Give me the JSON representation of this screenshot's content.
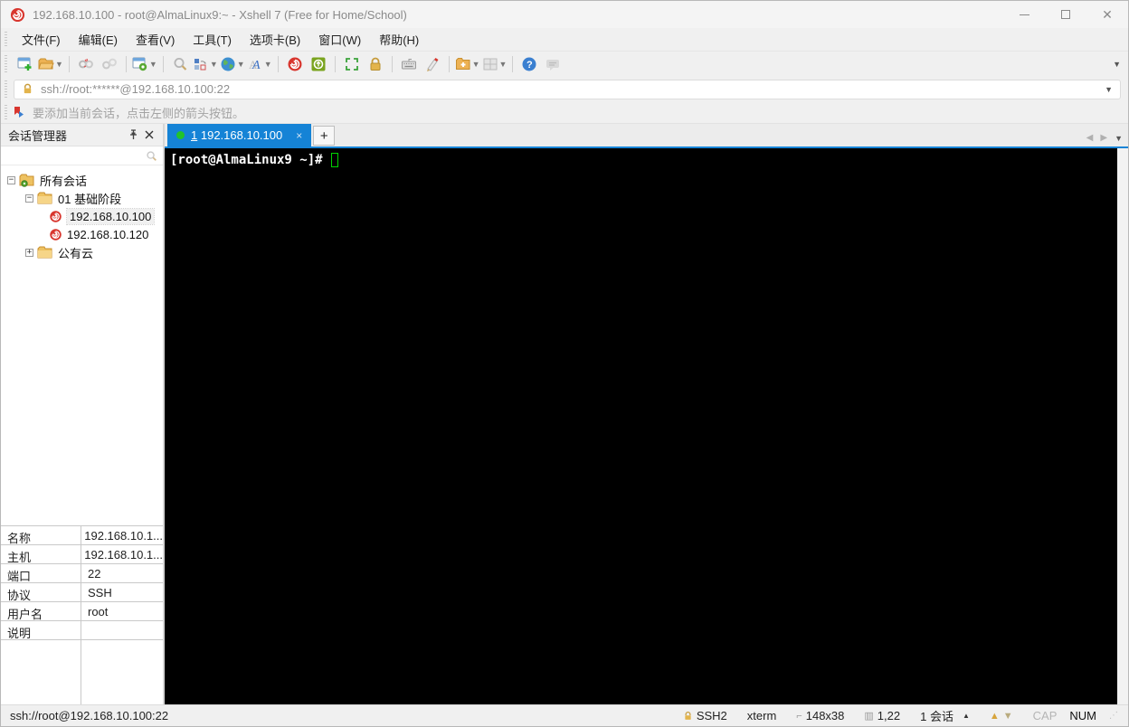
{
  "window": {
    "title": "192.168.10.100 - root@AlmaLinux9:~ - Xshell 7 (Free for Home/School)",
    "controls": {
      "minimize": "—",
      "maximize": "□",
      "close": "✕"
    }
  },
  "menu": {
    "items": [
      {
        "label": "文件(F)"
      },
      {
        "label": "编辑(E)"
      },
      {
        "label": "查看(V)"
      },
      {
        "label": "工具(T)"
      },
      {
        "label": "选项卡(B)"
      },
      {
        "label": "窗口(W)"
      },
      {
        "label": "帮助(H)"
      }
    ]
  },
  "toolbar": {
    "icons": [
      "new-session",
      "open-folder",
      "disconnect",
      "reconnect",
      "session-properties",
      "find",
      "arrange-layout",
      "web-browser",
      "fonts",
      "xshell",
      "xftp",
      "fullscreen",
      "lock-screen",
      "virtual-keyboard",
      "compose-pen",
      "new-file",
      "tile-windows",
      "help",
      "feedback"
    ]
  },
  "address_bar": {
    "value": "ssh://root:******@192.168.10.100:22"
  },
  "info_bar": {
    "text": "要添加当前会话，点击左侧的箭头按钮。"
  },
  "session_manager": {
    "title": "会话管理器",
    "tree": [
      {
        "label": "所有会话"
      },
      {
        "label": "01 基础阶段"
      },
      {
        "label": "192.168.10.100"
      },
      {
        "label": "192.168.10.120"
      },
      {
        "label": "公有云"
      }
    ],
    "expanders": {
      "minus": "−",
      "plus": "+"
    },
    "properties": [
      {
        "label": "名称",
        "value": "192.168.10.1..."
      },
      {
        "label": "主机",
        "value": "192.168.10.1..."
      },
      {
        "label": "端口",
        "value": "22"
      },
      {
        "label": "协议",
        "value": "SSH"
      },
      {
        "label": "用户名",
        "value": "root"
      },
      {
        "label": "说明",
        "value": ""
      }
    ]
  },
  "tabs": {
    "active": {
      "number": "1",
      "label": "192.168.10.100",
      "close": "×"
    },
    "new_tab": "+"
  },
  "terminal": {
    "prompt": "[root@AlmaLinux9 ~]# "
  },
  "status_bar": {
    "left": "ssh://root@192.168.10.100:22",
    "protocol": "SSH2",
    "term_type": "xterm",
    "size": "148x38",
    "cursor_pos": "1,22",
    "session_count": "1 会话",
    "cap": "CAP",
    "num": "NUM"
  },
  "colors": {
    "accent_blue": "#1583d6",
    "terminal_bg": "#000000",
    "cursor_green": "#00d400",
    "tab_dot_green": "#22c32a",
    "xshell_red": "#d8362e",
    "folder_gold": "#f0b44a",
    "chrome_gray": "#f0f0f0"
  }
}
